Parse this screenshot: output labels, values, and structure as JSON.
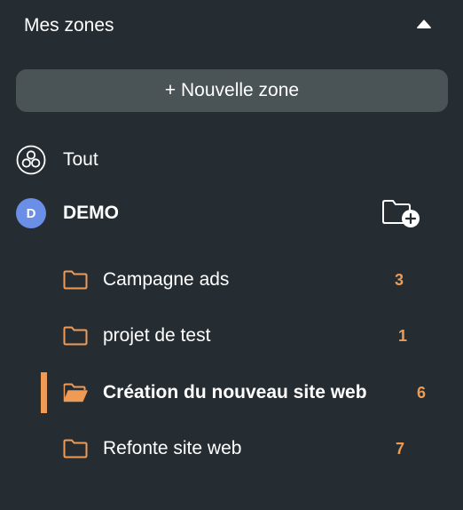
{
  "header": {
    "title": "Mes zones",
    "collapse_icon": "caret-up-icon"
  },
  "new_zone_button": {
    "label": "+ Nouvelle zone"
  },
  "all_item": {
    "label": "Tout",
    "icon": "three-circles-icon"
  },
  "workspace": {
    "avatar_letter": "D",
    "name": "DEMO",
    "avatar_color": "#6b8fe6",
    "add_folder_icon": "folder-plus-icon"
  },
  "folders": [
    {
      "label": "Campagne ads",
      "count": "3",
      "active": false
    },
    {
      "label": "projet de test",
      "count": "1",
      "active": false
    },
    {
      "label": "Création du nouveau site web",
      "count": "6",
      "active": true
    },
    {
      "label": "Refonte site web",
      "count": "7",
      "active": false
    }
  ],
  "colors": {
    "background": "#252d32",
    "button": "#4a5356",
    "accent": "#ef9a55",
    "text": "#ffffff"
  }
}
